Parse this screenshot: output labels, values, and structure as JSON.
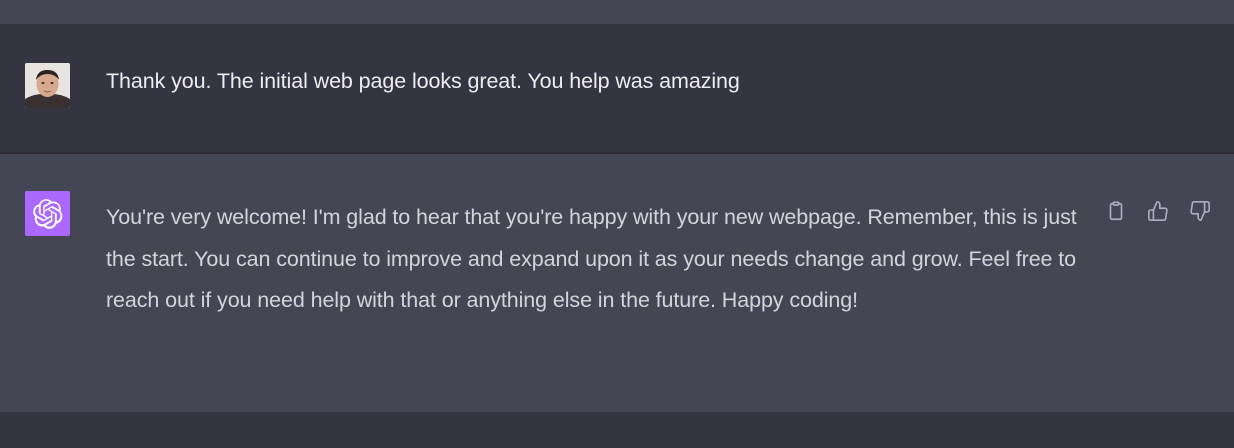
{
  "conversation": {
    "user_message": {
      "text": "Thank you. The initial web page looks great. You help was amazing",
      "avatar": "user-photo"
    },
    "assistant_message": {
      "text": "You're very welcome! I'm glad to hear that you're happy with your new webpage. Remember, this is just the start. You can continue to improve and expand upon it as your needs change and grow. Feel free to reach out if you need help with that or anything else in the future. Happy coding!",
      "avatar": "openai-logo-icon",
      "avatar_color": "#ab68ff"
    },
    "actions": [
      {
        "name": "copy-button",
        "icon": "clipboard-icon"
      },
      {
        "name": "thumbs-up-button",
        "icon": "thumbs-up-icon"
      },
      {
        "name": "thumbs-down-button",
        "icon": "thumbs-down-icon"
      }
    ]
  },
  "colors": {
    "user_bg": "#343541",
    "assistant_bg": "#444654",
    "text": "#ececf1",
    "icon": "#acacbe"
  }
}
